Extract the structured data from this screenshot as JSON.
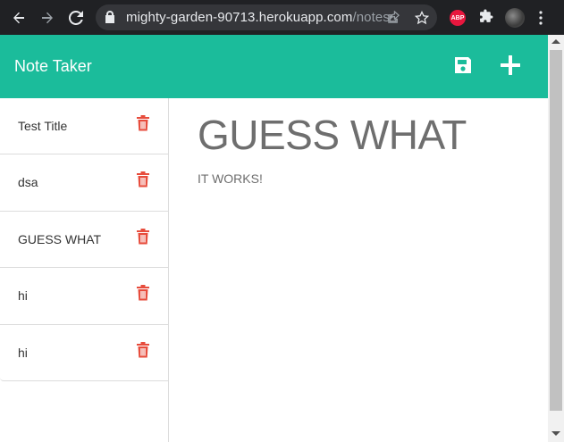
{
  "browser": {
    "url_host": "mighty-garden-90713.herokuapp.com",
    "url_path": "/notes",
    "extension_badge": "ABP",
    "icons": [
      "back-icon",
      "forward-icon",
      "reload-icon",
      "lock-icon",
      "share-icon",
      "star-icon",
      "abp-extension-icon",
      "puzzle-icon",
      "profile-avatar",
      "menu-dots-icon"
    ]
  },
  "header": {
    "title": "Note Taker",
    "icons": [
      "save-icon",
      "plus-icon"
    ]
  },
  "notes": [
    {
      "title": "Test Title"
    },
    {
      "title": "dsa"
    },
    {
      "title": "GUESS WHAT"
    },
    {
      "title": "hi"
    },
    {
      "title": "hi"
    }
  ],
  "active_note": {
    "title": "GUESS WHAT",
    "text": "IT WORKS!"
  },
  "colors": {
    "header_bg": "#1bbc9b",
    "trash": "#e74c3c",
    "chrome_bg": "#202124",
    "note_text": "#6e6e6e"
  }
}
